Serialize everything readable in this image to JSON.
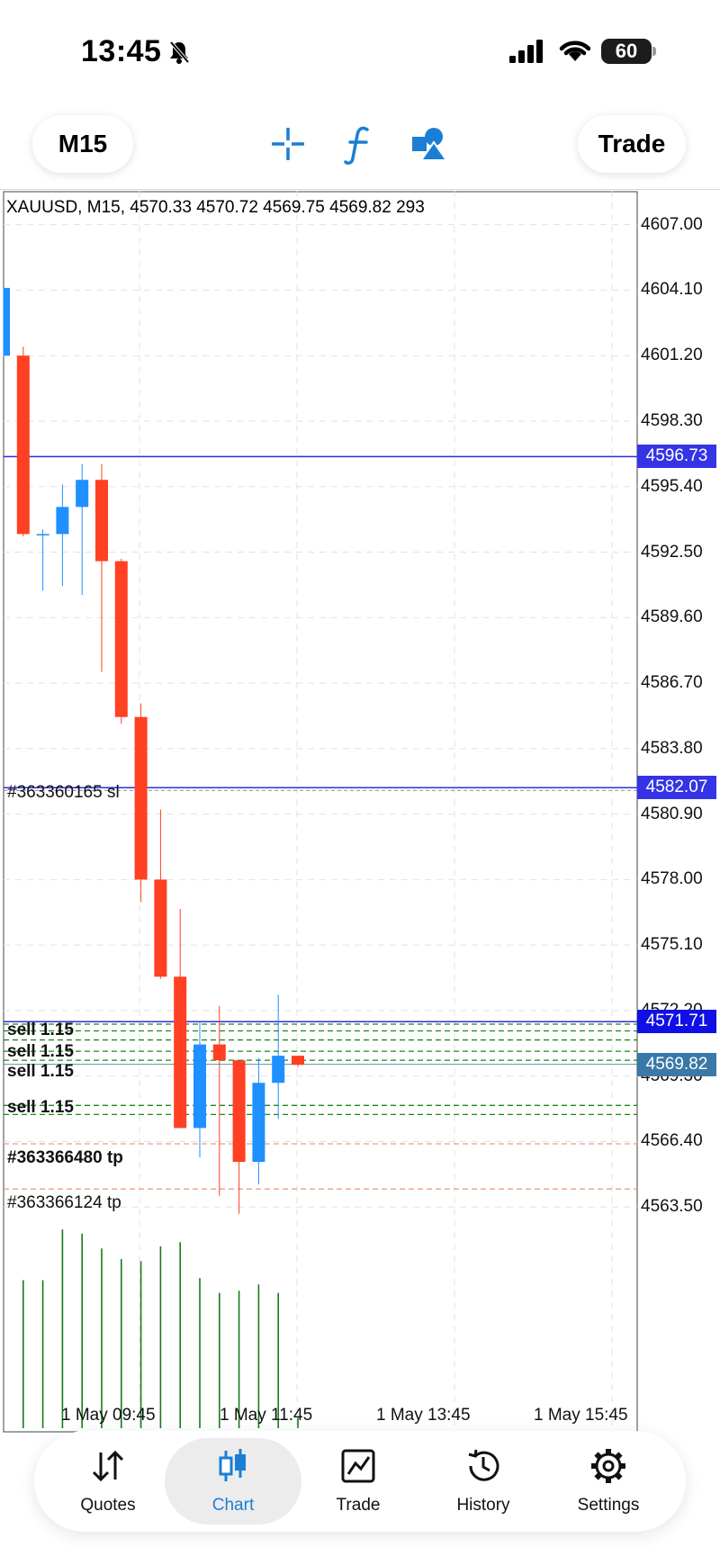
{
  "status": {
    "time": "13:45",
    "battery": "60"
  },
  "toolbar": {
    "timeframe": "M15",
    "trade_label": "Trade"
  },
  "chart": {
    "info": "XAUUSD, M15, 4570.33 4570.72 4569.75 4569.82 293",
    "price_labels": [
      "4607.00",
      "4604.10",
      "4601.20",
      "4598.30",
      "4595.40",
      "4592.50",
      "4589.60",
      "4586.70",
      "4583.80",
      "4580.90",
      "4578.00",
      "4575.10",
      "4572.20",
      "4569.30",
      "4566.40",
      "4563.50"
    ],
    "line_tags": {
      "upper": "4596.73",
      "middle": "4582.07",
      "order": "4571.71",
      "bid": "4569.82"
    },
    "time_labels": [
      "1 May 09:45",
      "1 May 11:45",
      "1 May 13:45",
      "1 May 15:45"
    ],
    "order_labels": {
      "sl_overlap": "#363360165 sl",
      "sell_a": "sell 1.15",
      "sell_b": "sell 1.15",
      "sell_c": "sell 1.15",
      "sell_d": "sell 1.15",
      "tp_a": "#363366480 tp",
      "tp_b": "#363366124 tp"
    },
    "colors": {
      "bull": "#1e90ff",
      "bear": "#ff4022",
      "volume": "#1a7a1a",
      "order_line": "#2f2fd8",
      "tp_line": "#e8a08a",
      "sell_line": "#1a8a1a"
    }
  },
  "chart_data": {
    "type": "candlestick",
    "symbol": "XAUUSD",
    "timeframe": "M15",
    "ylim": [
      4561.0,
      4608.5
    ],
    "candles": [
      {
        "o": 4601.2,
        "h": 4604.2,
        "l": 4601.2,
        "c": 4604.2
      },
      {
        "o": 4601.2,
        "h": 4601.6,
        "l": 4593.2,
        "c": 4593.3
      },
      {
        "o": 4593.3,
        "h": 4593.5,
        "l": 4590.8,
        "c": 4593.3
      },
      {
        "o": 4593.3,
        "h": 4595.5,
        "l": 4591.0,
        "c": 4594.5
      },
      {
        "o": 4594.5,
        "h": 4596.4,
        "l": 4590.6,
        "c": 4595.7
      },
      {
        "o": 4595.7,
        "h": 4596.4,
        "l": 4587.2,
        "c": 4592.1
      },
      {
        "o": 4592.1,
        "h": 4592.2,
        "l": 4584.9,
        "c": 4585.2
      },
      {
        "o": 4585.2,
        "h": 4585.8,
        "l": 4577.0,
        "c": 4578.0
      },
      {
        "o": 4578.0,
        "h": 4581.1,
        "l": 4573.6,
        "c": 4573.7
      },
      {
        "o": 4573.7,
        "h": 4576.7,
        "l": 4567.0,
        "c": 4567.0
      },
      {
        "o": 4567.0,
        "h": 4571.7,
        "l": 4565.7,
        "c": 4570.7
      },
      {
        "o": 4570.7,
        "h": 4572.4,
        "l": 4564.0,
        "c": 4570.0
      },
      {
        "o": 4570.0,
        "h": 4570.0,
        "l": 4563.2,
        "c": 4565.5
      },
      {
        "o": 4565.5,
        "h": 4570.1,
        "l": 4564.5,
        "c": 4569.0
      },
      {
        "o": 4569.0,
        "h": 4572.9,
        "l": 4567.4,
        "c": 4570.2
      },
      {
        "o": 4570.2,
        "h": 4570.2,
        "l": 4569.7,
        "c": 4569.8
      }
    ],
    "volumes": [
      0,
      0.7,
      0.7,
      0.94,
      0.92,
      0.85,
      0.8,
      0.79,
      0.86,
      0.88,
      0.71,
      0.64,
      0.65,
      0.68,
      0.64,
      0.05
    ],
    "lines": {
      "upper": 4596.73,
      "middle": 4582.07,
      "order": 4571.71,
      "bid": 4569.82,
      "tp_a": 4566.3,
      "tp_b": 4564.3
    },
    "sell_levels": [
      4571.6,
      4571.3,
      4570.9,
      4570.4,
      4570.0,
      4568.0,
      4567.6
    ]
  },
  "nav": {
    "items": [
      {
        "label": "Quotes"
      },
      {
        "label": "Chart"
      },
      {
        "label": "Trade"
      },
      {
        "label": "History"
      },
      {
        "label": "Settings"
      }
    ]
  }
}
